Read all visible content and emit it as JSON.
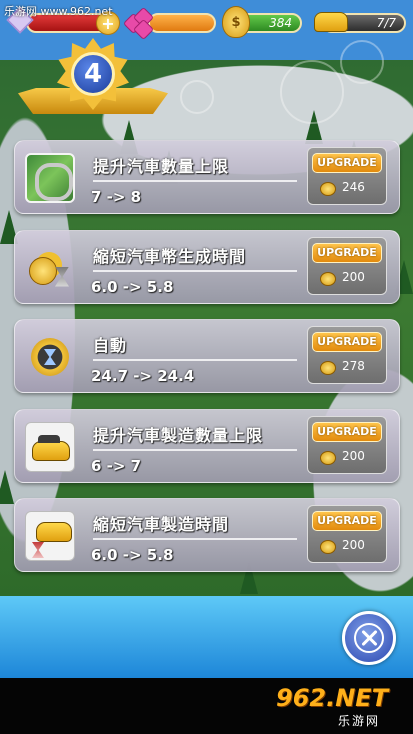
{
  "watermark": "乐游网 www.962.net",
  "status": {
    "cash": "384",
    "cars": "7/7"
  },
  "rank": {
    "level": "4"
  },
  "upgrades": [
    {
      "title": "提升汽車數量上限",
      "value": "7 -> 8",
      "button": "UPGRADE",
      "cost": "246",
      "icon": "track-map-icon"
    },
    {
      "title": "縮短汽車幣生成時間",
      "value": "6.0 -> 5.8",
      "button": "UPGRADE",
      "cost": "200",
      "icon": "coins-hourglass-icon"
    },
    {
      "title": "自動",
      "value": "24.7 -> 24.4",
      "button": "UPGRADE",
      "cost": "278",
      "icon": "auto-hourglass-icon"
    },
    {
      "title": "提升汽車製造數量上限",
      "value": "6 -> 7",
      "button": "UPGRADE",
      "cost": "200",
      "icon": "taxi-car-icon"
    },
    {
      "title": "縮短汽車製造時間",
      "value": "6.0 -> 5.8",
      "button": "UPGRADE",
      "cost": "200",
      "icon": "taxi-hourglass-icon"
    }
  ],
  "footer": {
    "logo": "962.NET",
    "logo_sub": "乐游网"
  },
  "colors": {
    "accent": "#f3c03a",
    "upgrade_button": "#f0a020",
    "panel_blue": "#1d86d8"
  }
}
